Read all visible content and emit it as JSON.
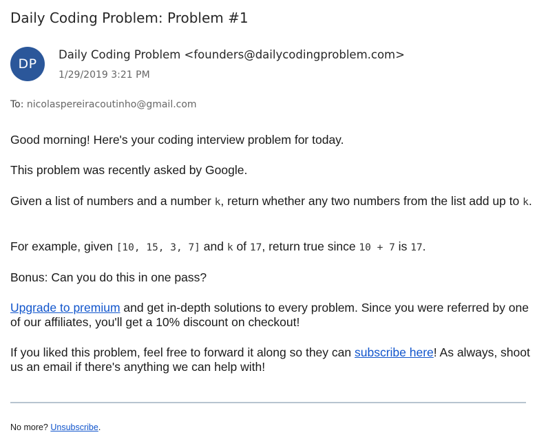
{
  "email": {
    "subject": "Daily Coding Problem: Problem #1",
    "avatar_initials": "DP",
    "avatar_color": "#2b579a",
    "sender": "Daily Coding Problem <founders@dailycodingproblem.com>",
    "date": "1/29/2019 3:21 PM",
    "to_label": "To:",
    "to_address": "nicolaspereiracoutinho@gmail.com"
  },
  "body": {
    "greeting": "Good morning! Here's your coding interview problem for today.",
    "asked_by": "This problem was recently asked by Google.",
    "problem": {
      "part1": "Given a list of numbers and a number ",
      "k1": "k",
      "part2": ", return whether any two numbers from the list add up to ",
      "k2": "k",
      "part3": "."
    },
    "example": {
      "part1": "For example, given ",
      "list": "[10, 15, 3, 7]",
      "part2": " and ",
      "k": "k",
      "part3": " of ",
      "k_value": "17",
      "part4": ", return true since ",
      "sum": "10 + 7",
      "part5": " is ",
      "result": "17",
      "part6": "."
    },
    "bonus": "Bonus: Can you do this in one pass?",
    "upgrade": {
      "link": "Upgrade to premium",
      "text": " and get in-depth solutions to every problem. Since you were referred by one of our affiliates, you'll get a 10% discount on checkout!"
    },
    "forward": {
      "part1": "If you liked this problem, feel free to forward it along so they can ",
      "link": "subscribe here",
      "part2": "! As always, shoot us an email if there's anything we can help with!"
    }
  },
  "footer": {
    "text": "No more? ",
    "unsubscribe_link": "Unsubscribe",
    "period": "."
  },
  "colors": {
    "link": "#1155cc",
    "divider": "#b7c4cf"
  }
}
